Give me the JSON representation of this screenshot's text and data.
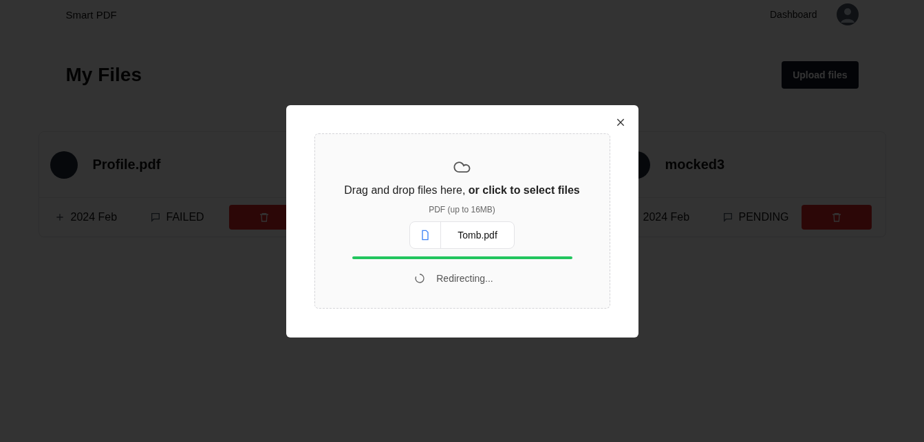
{
  "header": {
    "brand": "Smart PDF",
    "nav": [
      {
        "label": "Dashboard"
      }
    ]
  },
  "page": {
    "title": "My Files",
    "upload_button": "Upload files"
  },
  "files": [
    {
      "name": "Profile.pdf",
      "date": "2024 Feb",
      "status": "FAILED"
    },
    {
      "name": "mocked3",
      "date": "2024 Feb",
      "status": "PENDING"
    }
  ],
  "modal": {
    "prompt": "Drag and drop files here, **or click to select files**",
    "hint": "PDF (up to 16MB)",
    "file": "Tomb.pdf",
    "progress": {
      "level": 1
    },
    "status": "Redirecting..."
  }
}
